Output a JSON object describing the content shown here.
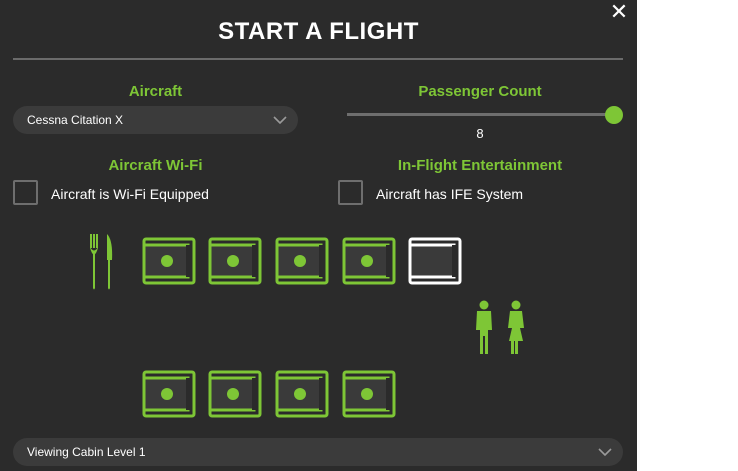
{
  "dialog": {
    "title": "START A FLIGHT",
    "close_glyph": "✕"
  },
  "aircraft": {
    "label": "Aircraft",
    "selected": "Cessna Citation X"
  },
  "passengers": {
    "label": "Passenger Count",
    "value": "8",
    "slider_fraction": 1.0
  },
  "wifi": {
    "label": "Aircraft Wi-Fi",
    "checkbox_label": "Aircraft is Wi-Fi Equipped",
    "checked": false
  },
  "ife": {
    "label": "In-Flight Entertainment",
    "checkbox_label": "Aircraft has IFE System",
    "checked": false
  },
  "cabin": {
    "viewing_label": "Viewing Cabin Level 1",
    "top_row_seats": [
      "occupied",
      "occupied",
      "occupied",
      "occupied",
      "empty"
    ],
    "bottom_row_seats": [
      "occupied",
      "occupied",
      "occupied",
      "occupied"
    ]
  },
  "icons": {
    "galley": "fork-knife-icon",
    "lavatory": "restroom-icon",
    "chevron": "chevron-down-icon"
  },
  "colors": {
    "accent": "#7ec636",
    "background": "#2b2b2b",
    "empty_seat": "#ffffff"
  }
}
